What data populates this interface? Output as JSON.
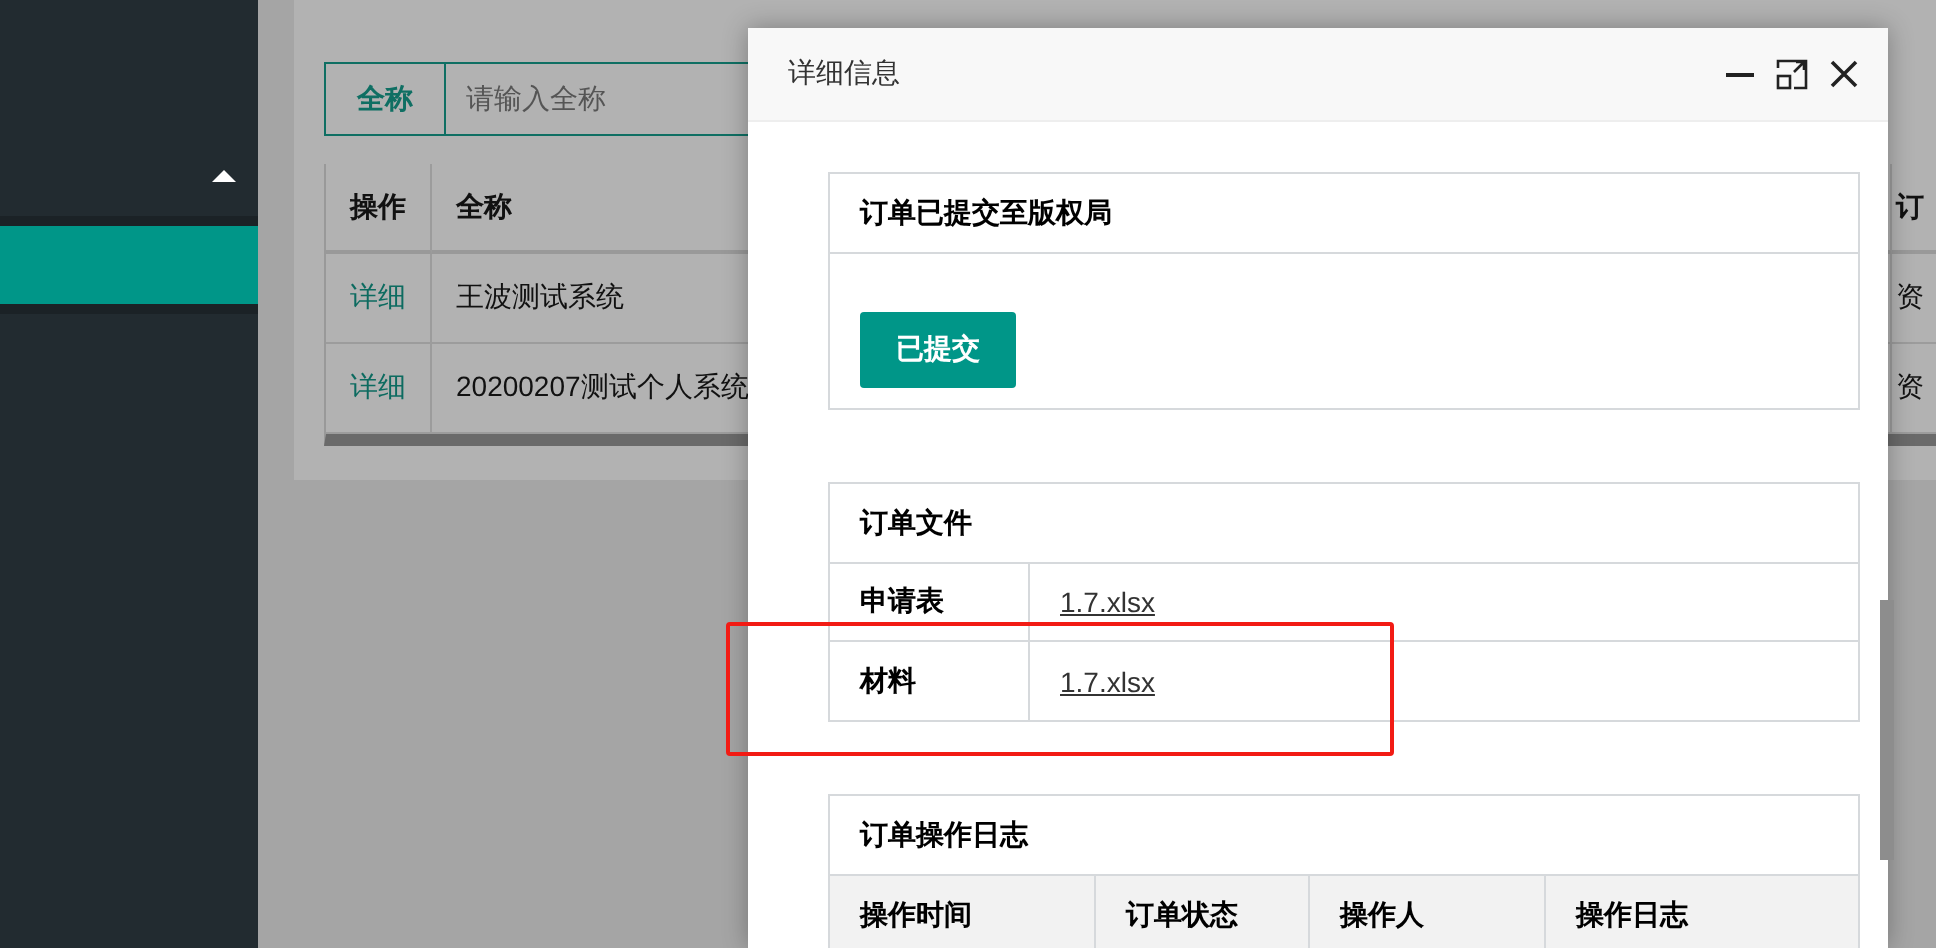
{
  "sidebar": {
    "items": [
      {
        "selected": true
      }
    ]
  },
  "search": {
    "label": "全称",
    "placeholder": "请输入全称"
  },
  "table": {
    "columns": [
      "操作",
      "全称",
      "订"
    ],
    "rows": [
      {
        "action": "详细",
        "name": "王波测试系统",
        "column_3": "资"
      },
      {
        "action": "详细",
        "name": "20200207测试个人系统",
        "column_3": "资"
      }
    ]
  },
  "dialog": {
    "title": "详细信息",
    "status_section": {
      "title": "订单已提交至版权局",
      "button": "已提交"
    },
    "files_section": {
      "title": "订单文件",
      "rows": [
        {
          "label": "申请表",
          "file": "1.7.xlsx"
        },
        {
          "label": "材料",
          "file": "1.7.xlsx"
        }
      ]
    },
    "log_section": {
      "title": "订单操作日志",
      "columns": [
        "操作时间",
        "订单状态",
        "操作人",
        "操作日志"
      ]
    }
  }
}
